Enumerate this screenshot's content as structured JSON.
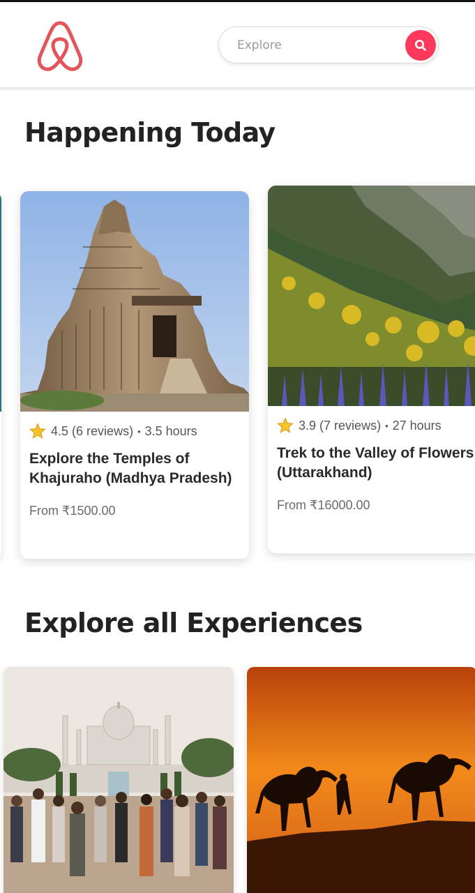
{
  "header": {
    "search": {
      "placeholder": "Explore"
    }
  },
  "sections": {
    "happening_today": "Happening Today",
    "explore_all": "Explore all Experiences"
  },
  "cards": [
    {
      "rating": "4.5",
      "reviews": "(6 reviews)",
      "duration": "3.5 hours",
      "title": "Explore the Temples of Khajuraho (Madhya Pradesh)",
      "price": "From ₹1500.00"
    },
    {
      "rating": "3.9",
      "reviews": "(7 reviews)",
      "duration": "27 hours",
      "title": "Trek to the Valley of Flowers (Uttarakhand)",
      "price": "From ₹16000.00"
    }
  ],
  "colors": {
    "brand": "#ff385c",
    "logo": "#e0565b",
    "text": "#222222",
    "muted": "#6b6b6b"
  },
  "icons": {
    "logo": "airbnb-logo-icon",
    "search": "search-icon",
    "rating": "star-icon"
  }
}
